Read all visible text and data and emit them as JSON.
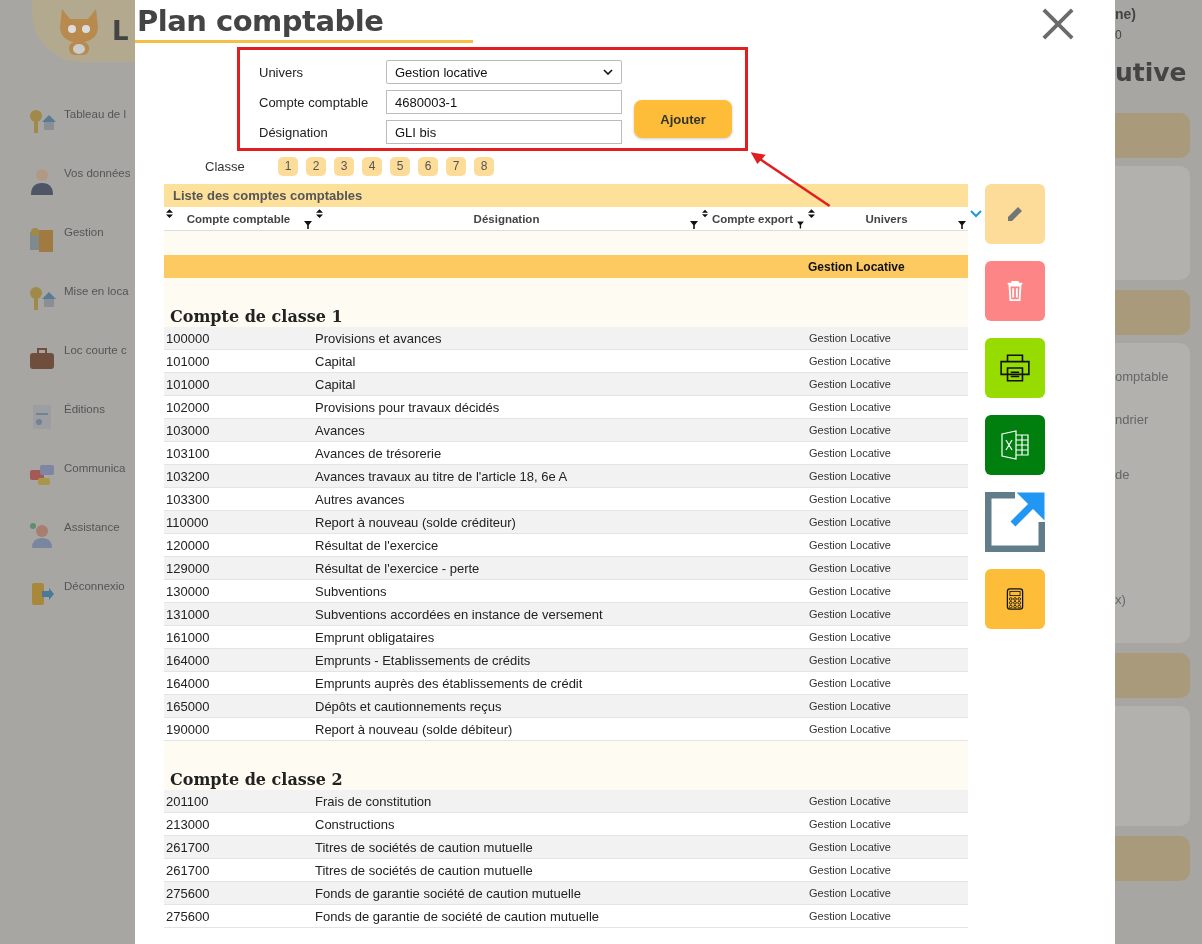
{
  "background": {
    "logo_text": "L",
    "sidebar": [
      {
        "label": "Tableau de l"
      },
      {
        "label": "Vos données"
      },
      {
        "label": "Gestion"
      },
      {
        "label": "Mise en loca"
      },
      {
        "label": "Loc courte c"
      },
      {
        "label": "Éditions"
      },
      {
        "label": "Communica"
      },
      {
        "label": "Assistance"
      },
      {
        "label": "Déconnexio"
      }
    ],
    "right": {
      "header_text": "ne)",
      "header_sub": "0",
      "title": "utive",
      "card_texts": [
        "omptable",
        "ndrier",
        "de",
        "x)"
      ]
    }
  },
  "modal": {
    "title": "Plan comptable",
    "form": {
      "univers_label": "Univers",
      "univers_value": "Gestion locative",
      "account_label": "Compte comptable",
      "account_value": "4680003-1",
      "designation_label": "Désignation",
      "designation_value": "GLI bis",
      "add_button": "Ajouter"
    },
    "class_label": "Classe",
    "classes": [
      "1",
      "2",
      "3",
      "4",
      "5",
      "6",
      "7",
      "8"
    ],
    "table": {
      "title": "Liste des comptes comptables",
      "columns": [
        "Compte comptable",
        "Désignation",
        "Compte export",
        "Univers"
      ],
      "group_row": "Gestion Locative",
      "sections": [
        {
          "heading": "Compte de classe 1",
          "rows": [
            {
              "code": "100000",
              "designation": "Provisions et avances",
              "univers": "Gestion Locative"
            },
            {
              "code": "101000",
              "designation": "Capital",
              "univers": "Gestion Locative"
            },
            {
              "code": "101000",
              "designation": "Capital",
              "univers": "Gestion Locative"
            },
            {
              "code": "102000",
              "designation": "Provisions pour travaux décidés",
              "univers": "Gestion Locative"
            },
            {
              "code": "103000",
              "designation": "Avances",
              "univers": "Gestion Locative"
            },
            {
              "code": "103100",
              "designation": "Avances de trésorerie",
              "univers": "Gestion Locative"
            },
            {
              "code": "103200",
              "designation": "Avances travaux au titre de l'article 18, 6e A",
              "univers": "Gestion Locative"
            },
            {
              "code": "103300",
              "designation": "Autres avances",
              "univers": "Gestion Locative"
            },
            {
              "code": "110000",
              "designation": "Report à nouveau (solde créditeur)",
              "univers": "Gestion Locative"
            },
            {
              "code": "120000",
              "designation": "Résultat de l'exercice",
              "univers": "Gestion Locative"
            },
            {
              "code": "129000",
              "designation": "Résultat de l'exercice - perte",
              "univers": "Gestion Locative"
            },
            {
              "code": "130000",
              "designation": "Subventions",
              "univers": "Gestion Locative"
            },
            {
              "code": "131000",
              "designation": "Subventions accordées en instance de versement",
              "univers": "Gestion Locative"
            },
            {
              "code": "161000",
              "designation": "Emprunt obligataires",
              "univers": "Gestion Locative"
            },
            {
              "code": "164000",
              "designation": "Emprunts - Etablissements de crédits",
              "univers": "Gestion Locative"
            },
            {
              "code": "164000",
              "designation": "Emprunts auprès des établissements de crédit",
              "univers": "Gestion Locative"
            },
            {
              "code": "165000",
              "designation": "Dépôts et cautionnements reçus",
              "univers": "Gestion Locative"
            },
            {
              "code": "190000",
              "designation": "Report à nouveau (solde débiteur)",
              "univers": "Gestion Locative"
            }
          ]
        },
        {
          "heading": "Compte de classe 2",
          "rows": [
            {
              "code": "201100",
              "designation": "Frais de constitution",
              "univers": "Gestion Locative"
            },
            {
              "code": "213000",
              "designation": "Constructions",
              "univers": "Gestion Locative"
            },
            {
              "code": "261700",
              "designation": "Titres de sociétés de caution mutuelle",
              "univers": "Gestion Locative"
            },
            {
              "code": "261700",
              "designation": "Titres de sociétés de caution mutuelle",
              "univers": "Gestion Locative"
            },
            {
              "code": "275600",
              "designation": "Fonds de garantie société de caution mutuelle",
              "univers": "Gestion Locative"
            },
            {
              "code": "275600",
              "designation": "Fonds de garantie de société de caution mutuelle",
              "univers": "Gestion Locative"
            }
          ]
        }
      ]
    },
    "actions": [
      {
        "kind": "edit"
      },
      {
        "kind": "delete"
      },
      {
        "kind": "print"
      },
      {
        "kind": "excel"
      },
      {
        "kind": "export"
      },
      {
        "kind": "calculator"
      }
    ]
  }
}
